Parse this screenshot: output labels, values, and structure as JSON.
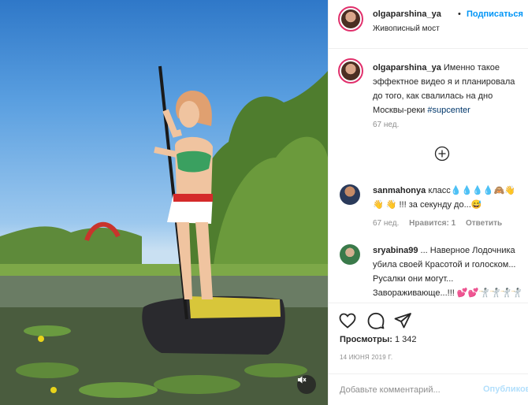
{
  "post": {
    "username": "olgaparshina_ya",
    "dot": "•",
    "follow_label": "Подписаться",
    "location": "Живописный мост"
  },
  "caption": {
    "username": "olgaparshina_ya",
    "text": "Именно такое эффектное видео я и планировала до того, как свалилась на дно Москвы-реки",
    "hashtag": "#supcenter",
    "time": "67 нед."
  },
  "comments": [
    {
      "username": "sanmahonya",
      "text": "класс💧💧💧💧🙈👋👋 👋 !!! за секунду до...😅",
      "time": "67 нед.",
      "likes": "Нравится: 1",
      "reply": "Ответить"
    },
    {
      "username": "sryabina99",
      "text": "... Наверное Лодочника убила своей Красотой и голоском... Русалки они могут... Завораживающе...!!! 💕💕🤺🤺🤺🤺🤺🤺",
      "time": "",
      "likes": "",
      "reply": ""
    }
  ],
  "stats": {
    "views_label": "Просмотры:",
    "views_count": "1 342",
    "date": "14 ИЮНЯ 2019 Г."
  },
  "add_comment": {
    "placeholder": "Добавьте комментарий...",
    "post_label": "Опубликовать"
  },
  "icons": {
    "like": "heart-icon",
    "comment": "comment-bubble-icon",
    "share": "paper-plane-icon",
    "more": "plus-circle-icon",
    "mute": "speaker-muted-icon"
  },
  "colors": {
    "link": "#0095f6",
    "hashtag": "#00376b",
    "muted": "#8e8e8e",
    "post_disabled": "#b2dffc"
  }
}
